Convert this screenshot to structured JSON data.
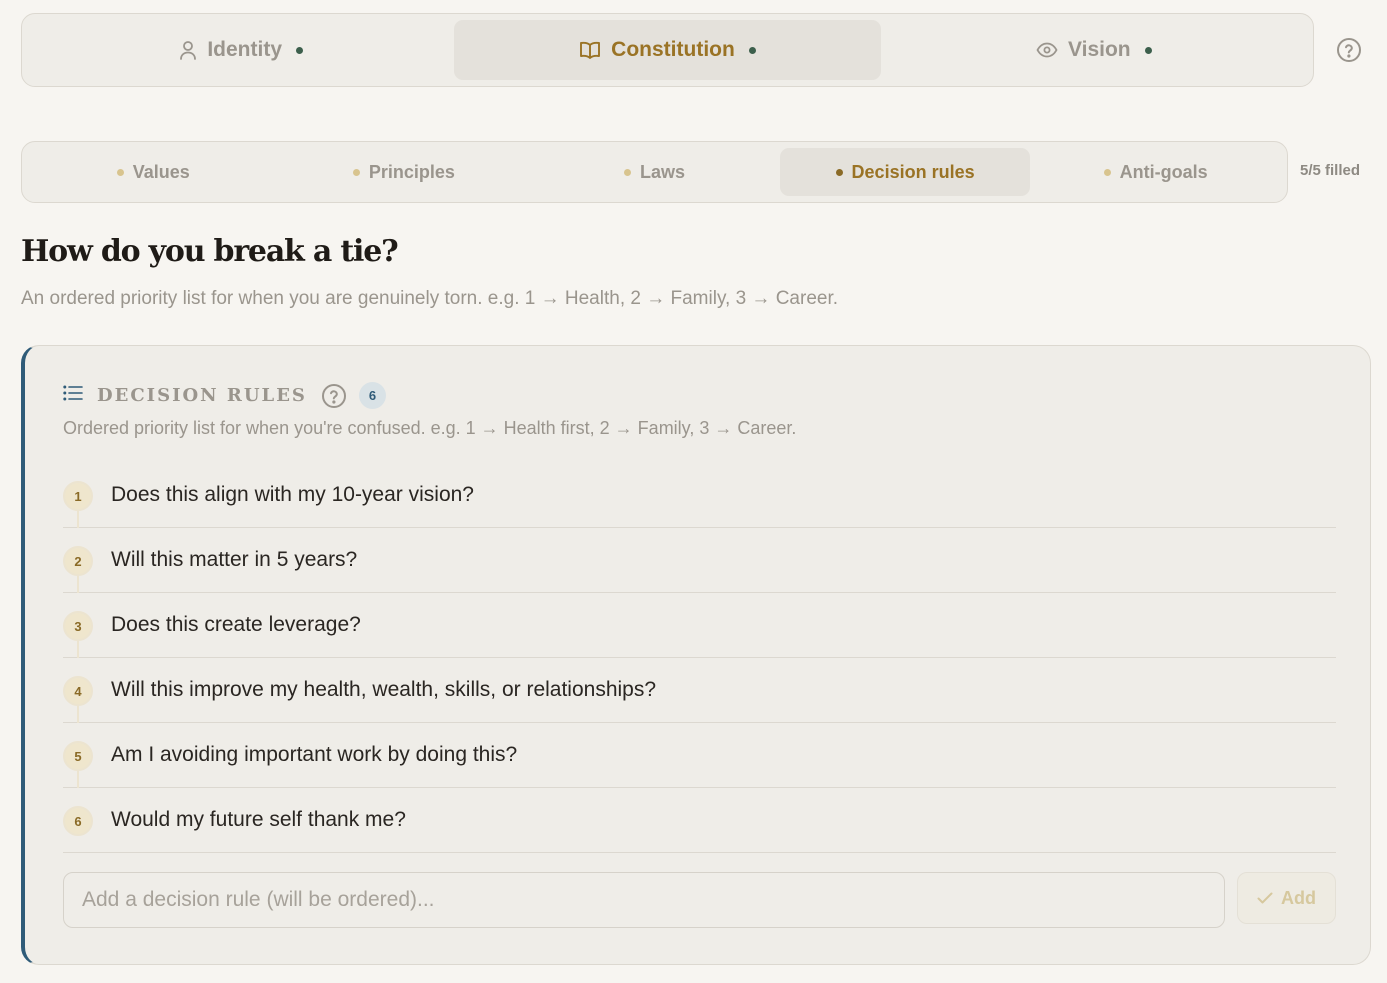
{
  "top_tabs": [
    {
      "label": "Identity",
      "icon": "user-icon",
      "active": false
    },
    {
      "label": "Constitution",
      "icon": "book-icon",
      "active": true
    },
    {
      "label": "Vision",
      "icon": "eye-icon",
      "active": false
    }
  ],
  "sub_tabs": [
    {
      "label": "Values",
      "active": false
    },
    {
      "label": "Principles",
      "active": false
    },
    {
      "label": "Laws",
      "active": false
    },
    {
      "label": "Decision rules",
      "active": true
    },
    {
      "label": "Anti-goals",
      "active": false
    }
  ],
  "filled_status": "5/5 filled",
  "page": {
    "title": "How do you break a tie?",
    "subtitle": "An ordered priority list for when you are genuinely torn. e.g. 1 → Health, 2 → Family, 3 → Career."
  },
  "card": {
    "title": "DECISION RULES",
    "count": "6",
    "description": "Ordered priority list for when you're confused. e.g. 1 → Health first, 2 → Family, 3 → Career.",
    "rules": [
      {
        "num": "1",
        "text": "Does this align with my 10-year vision?"
      },
      {
        "num": "2",
        "text": "Will this matter in 5 years?"
      },
      {
        "num": "3",
        "text": "Does this create leverage?"
      },
      {
        "num": "4",
        "text": "Will this improve my health, wealth, skills, or relationships?"
      },
      {
        "num": "5",
        "text": "Am I avoiding important work by doing this?"
      },
      {
        "num": "6",
        "text": "Would my future self thank me?"
      }
    ],
    "input_placeholder": "Add a decision rule (will be ordered)...",
    "add_label": "Add"
  },
  "colors": {
    "accent": "#9a7325",
    "card_border_accent": "#2f5b78",
    "status_dot": "#3c5f4c"
  }
}
